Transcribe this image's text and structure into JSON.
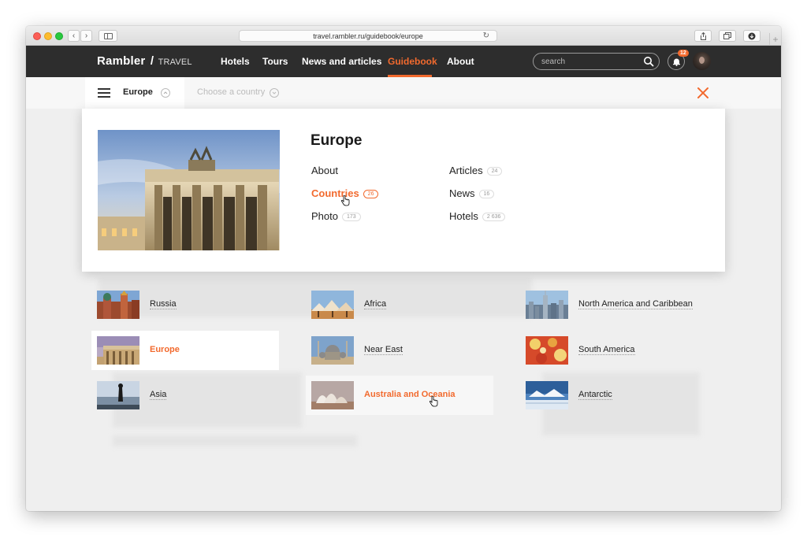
{
  "browser": {
    "url": "travel.rambler.ru/guidebook/europe"
  },
  "site": {
    "logo_brand": "Rambler",
    "logo_slash": "/",
    "logo_section": "TRAVEL",
    "nav": [
      {
        "label": "Hotels",
        "active": false
      },
      {
        "label": "Tours",
        "active": false
      },
      {
        "label": "News and articles",
        "active": false
      },
      {
        "label": "Guidebook",
        "active": true
      },
      {
        "label": "About",
        "active": false
      }
    ],
    "search_placeholder": "search",
    "notifications_count": "12",
    "accent_color": "#f26a2e"
  },
  "subnav": {
    "region": "Europe",
    "country_placeholder": "Choose a country"
  },
  "card": {
    "title": "Europe",
    "links": [
      {
        "label": "About",
        "count": ""
      },
      {
        "label": "Countries",
        "count": "26",
        "active": true
      },
      {
        "label": "Photo",
        "count": "173"
      },
      {
        "label": "Articles",
        "count": "24"
      },
      {
        "label": "News",
        "count": "16"
      },
      {
        "label": "Hotels",
        "count": "2 636"
      }
    ]
  },
  "regions": [
    {
      "label": "Russia",
      "thumb": "russia-image"
    },
    {
      "label": "Africa",
      "thumb": "africa-image"
    },
    {
      "label": "North America and Caribbean",
      "thumb": "north-america-image"
    },
    {
      "label": "Europe",
      "thumb": "europe-image",
      "selected": true
    },
    {
      "label": "Near East",
      "thumb": "near-east-image"
    },
    {
      "label": "South America",
      "thumb": "south-america-image"
    },
    {
      "label": "Asia",
      "thumb": "asia-image"
    },
    {
      "label": "Australia and Oceania",
      "thumb": "australia-image",
      "hover": true
    },
    {
      "label": "Antarctic",
      "thumb": "antarctic-image"
    }
  ]
}
